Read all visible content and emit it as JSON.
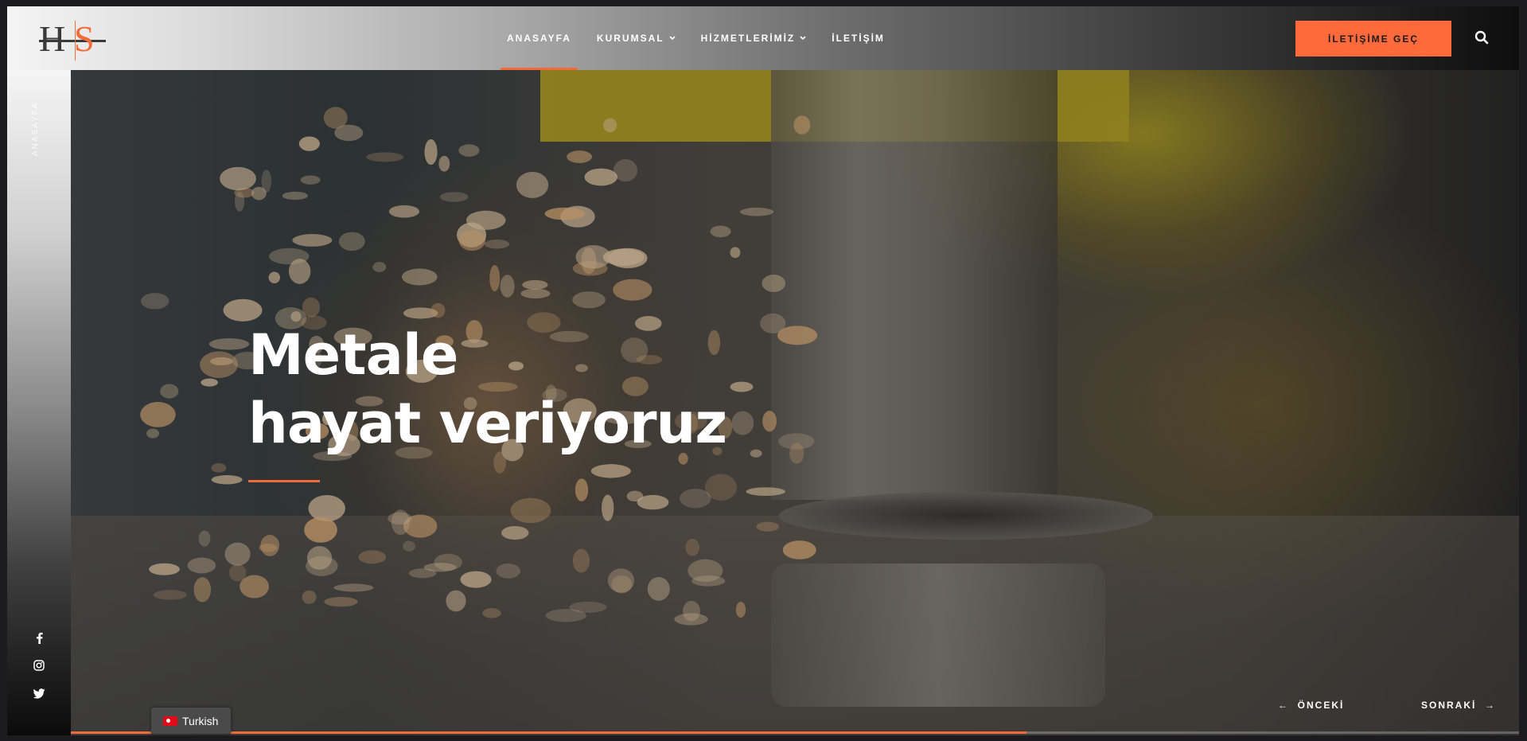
{
  "logo": {
    "h_letter": "H",
    "s_letter": "S"
  },
  "nav": {
    "items": [
      {
        "label": "ANASAYFA",
        "active": true,
        "dropdown": false
      },
      {
        "label": "KURUMSAL",
        "active": false,
        "dropdown": true
      },
      {
        "label": "HİZMETLERİMİZ",
        "active": false,
        "dropdown": true
      },
      {
        "label": "İLETİŞİM",
        "active": false,
        "dropdown": false
      }
    ],
    "cta_label": "İLETİŞİME GEÇ",
    "search_icon": "search-icon"
  },
  "sidebar": {
    "label": "ANASAYFA",
    "social": [
      "facebook-icon",
      "instagram-icon",
      "twitter-icon"
    ]
  },
  "hero": {
    "line1": "Metale",
    "line2": "hayat veriyoruz"
  },
  "slider": {
    "prev_label": "ÖNCEKİ",
    "next_label": "SONRAKİ",
    "progress": 0.66
  },
  "language": {
    "label": "Turkish"
  },
  "colors": {
    "accent": "#f26b3a",
    "cta_bg": "#ff6a3d"
  }
}
